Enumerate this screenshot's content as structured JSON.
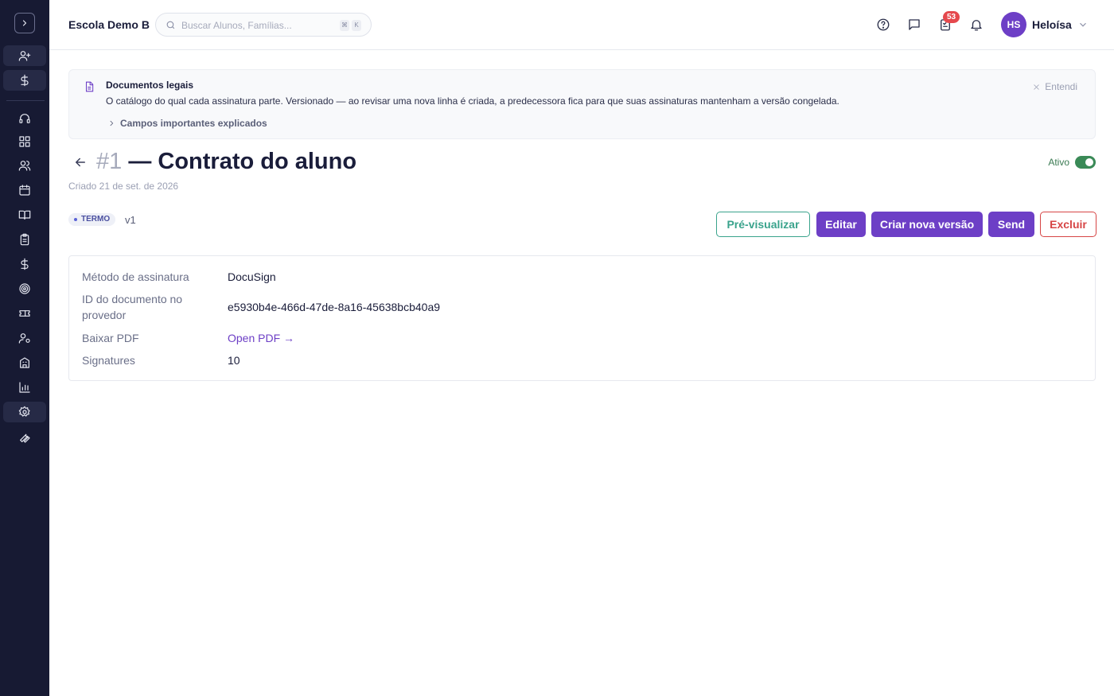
{
  "app": {
    "school_name": "Escola Demo B",
    "search_placeholder": "Buscar Alunos, Famílias...",
    "search_shortcut": [
      "⌘",
      "K"
    ],
    "notifications_count": "53",
    "user": {
      "initials": "HS",
      "name": "Heloísa"
    }
  },
  "sidebar": {
    "icons": [
      "chevron-right-icon",
      "user-plus-icon",
      "dollar-icon",
      "headset-icon",
      "dashboard-icon",
      "users-icon",
      "calendar-icon",
      "book-icon",
      "clipboard-icon",
      "dollar-icon",
      "target-icon",
      "ticket-icon",
      "user-settings-icon",
      "building-icon",
      "bar-chart-icon",
      "gear-icon",
      "wrench-icon"
    ]
  },
  "info": {
    "title": "Documentos legais",
    "description": "O catálogo do qual cada assinatura parte. Versionado — ao revisar uma nova linha é criada, a predecessora fica para que suas assinaturas mantenham a versão congelada.",
    "expand_label": "Campos importantes explicados",
    "dismiss_label": "Entendi"
  },
  "page": {
    "number": "#1",
    "title": "— Contrato do aluno",
    "created": "Criado 21 de set. de 2026",
    "status_label": "Ativo",
    "status_active": true,
    "tag": "TERMO",
    "version": "v1"
  },
  "actions": {
    "preview": "Pré-visualizar",
    "edit": "Editar",
    "new_version": "Criar nova versão",
    "send": "Send",
    "delete": "Excluir"
  },
  "details": {
    "rows": [
      {
        "label": "Método de assinatura",
        "value": "DocuSign"
      },
      {
        "label": "ID do documento no provedor",
        "value": "e5930b4e-466d-47de-8a16-45638bcb40a9"
      },
      {
        "label": "Baixar PDF",
        "value": "Open PDF →"
      },
      {
        "label": "Signatures",
        "value": "10"
      }
    ]
  },
  "colors": {
    "sidebar_bg": "#171a33",
    "primary": "#6d3fc6",
    "teal": "#3aa38c",
    "danger": "#d64545",
    "active_green": "#3a8a57",
    "badge_red": "#e5484d"
  }
}
